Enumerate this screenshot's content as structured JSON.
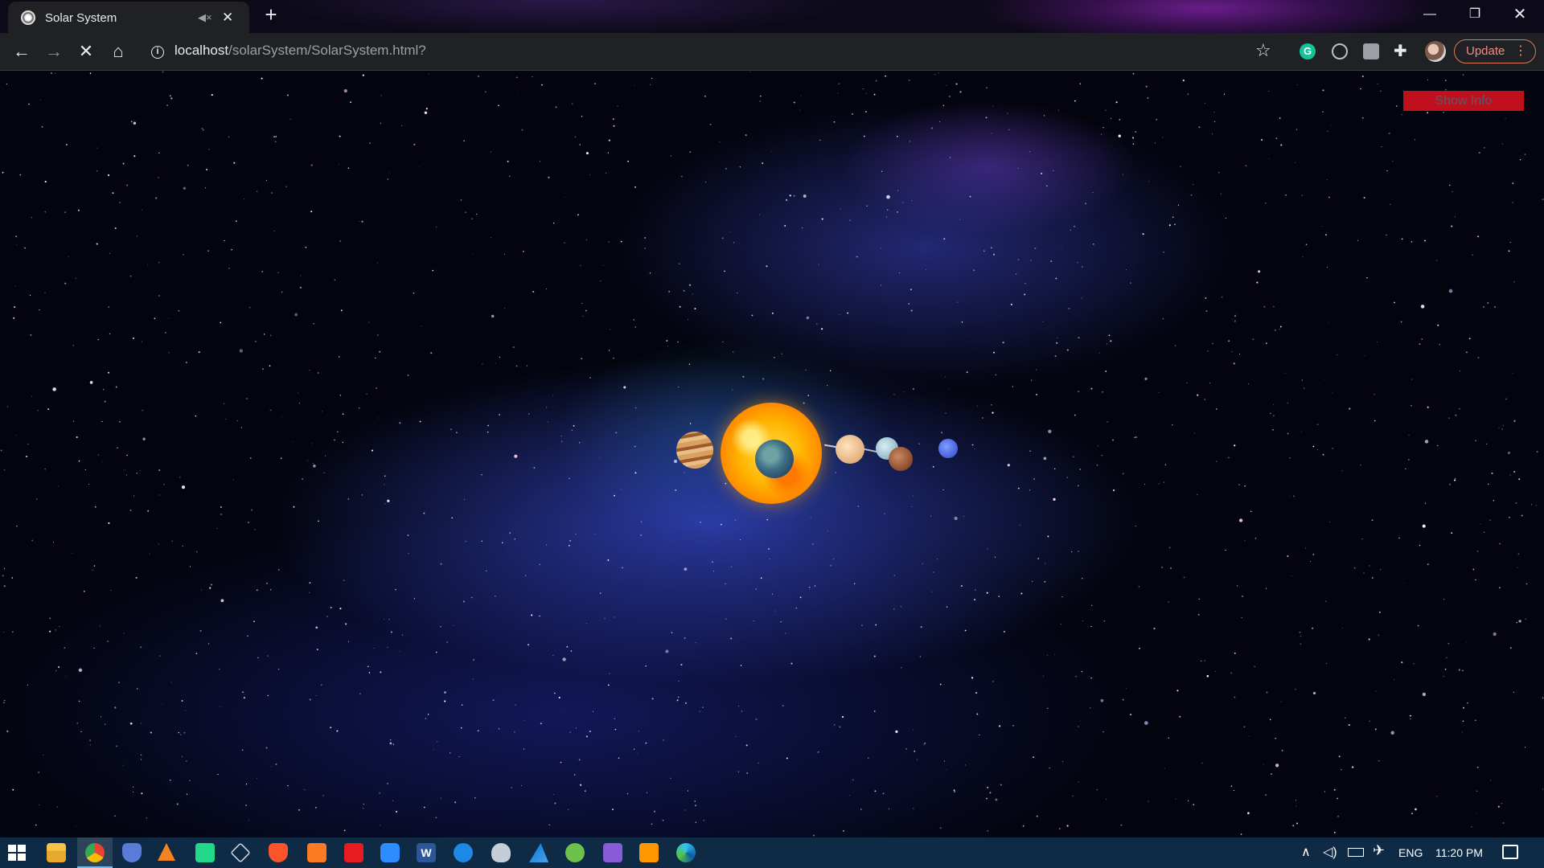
{
  "browser": {
    "tab": {
      "title": "Solar System",
      "mute_icon": "speaker-muted-icon",
      "close": "✕"
    },
    "new_tab": "+",
    "window_controls": {
      "minimize": "—",
      "restore": "❐",
      "close": "✕"
    },
    "nav": {
      "back": "←",
      "forward": "→",
      "stop": "✕",
      "home": "⌂"
    },
    "address": {
      "host": "localhost",
      "path": "/solarSystem/SolarSystem.html?"
    },
    "update_button": "Update"
  },
  "page": {
    "show_info_button": "Show Info"
  },
  "colors": {
    "show_info_bg": "#c0101e",
    "chrome_bg": "#202124",
    "taskbar_bg": "#0f2a44"
  },
  "taskbar": {
    "apps": [
      "start",
      "file-explorer",
      "chrome",
      "security-shield",
      "vlc",
      "pycharm",
      "3d-cube",
      "brave",
      "xampp",
      "acrobat",
      "zoom",
      "word",
      "chat",
      "mysql-workbench",
      "azure",
      "node",
      "visual-studio",
      "sublime-text",
      "edge"
    ],
    "word_label": "W",
    "tray": {
      "language": "ENG",
      "time": "11:20 PM"
    }
  }
}
